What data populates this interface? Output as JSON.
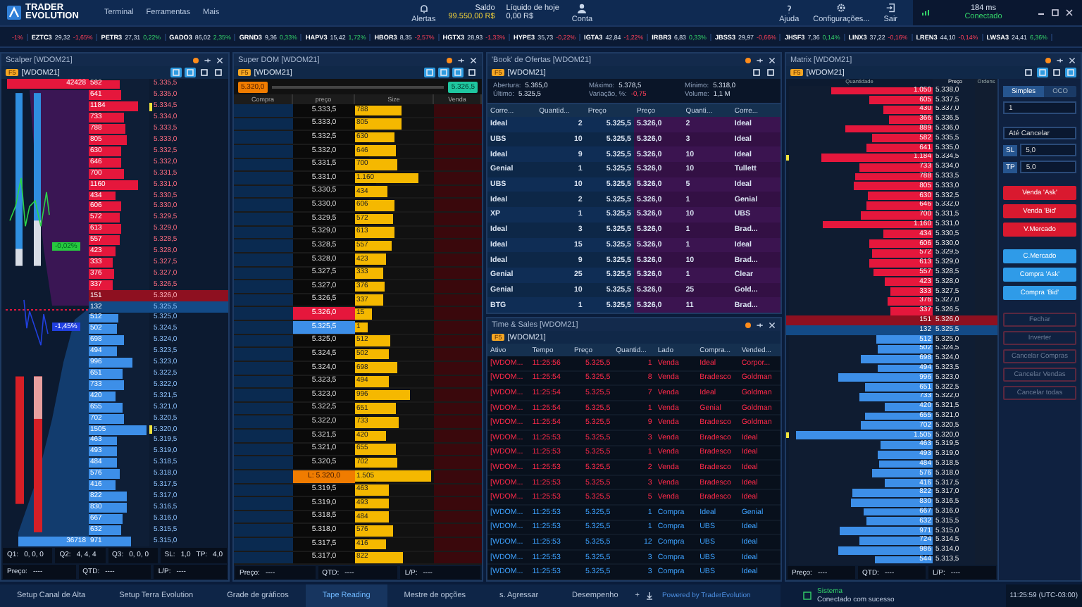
{
  "header": {
    "logo_top": "TRADER",
    "logo_bottom": "EVOLUTION",
    "menu": [
      "Terminal",
      "Ferramentas",
      "Mais"
    ],
    "alerts": "Alertas",
    "balance": {
      "label": "Saldo",
      "value": "99.550,00 R$"
    },
    "today": {
      "label": "Líquido de hoje",
      "value": "0,00 R$"
    },
    "account": "Conta",
    "actions": [
      {
        "label": "Ajuda",
        "kind": "help"
      },
      {
        "label": "Configurações...",
        "kind": "settings"
      },
      {
        "label": "Sair",
        "kind": "exit"
      }
    ],
    "latency": "184 ms",
    "connection": "Conectado"
  },
  "ticker": {
    "cut_change": "-1%",
    "items": [
      {
        "symbol": "EZTC3",
        "price": "29,32",
        "change": "-1,65%",
        "up": false
      },
      {
        "symbol": "PETR3",
        "price": "27,31",
        "change": "0,22%",
        "up": true
      },
      {
        "symbol": "GADO3",
        "price": "86,02",
        "change": "2,35%",
        "up": true
      },
      {
        "symbol": "GRND3",
        "price": "9,36",
        "change": "0,33%",
        "up": true
      },
      {
        "symbol": "HAPV3",
        "price": "15,42",
        "change": "1,72%",
        "up": true
      },
      {
        "symbol": "HBOR3",
        "price": "8,35",
        "change": "-2,57%",
        "up": false
      },
      {
        "symbol": "HGTX3",
        "price": "28,93",
        "change": "-1,33%",
        "up": false
      },
      {
        "symbol": "HYPE3",
        "price": "35,73",
        "change": "-0,22%",
        "up": false
      },
      {
        "symbol": "IGTA3",
        "price": "42,84",
        "change": "-1,22%",
        "up": false
      },
      {
        "symbol": "IRBR3",
        "price": "6,83",
        "change": "0,33%",
        "up": true
      },
      {
        "symbol": "JBSS3",
        "price": "29,97",
        "change": "-0,66%",
        "up": false
      },
      {
        "symbol": "JHSF3",
        "price": "7,36",
        "change": "0,14%",
        "up": true
      },
      {
        "symbol": "LINX3",
        "price": "37,22",
        "change": "-0,16%",
        "up": false
      },
      {
        "symbol": "LREN3",
        "price": "44,10",
        "change": "-0,14%",
        "up": false
      },
      {
        "symbol": "LWSA3",
        "price": "24,41",
        "change": "6,36%",
        "up": true
      }
    ]
  },
  "scalper": {
    "title": "Scalper [WDOM21]",
    "chip": "F5",
    "symbol": "[WDOM21]",
    "top_volume": "42428",
    "bottom_volume": "36718",
    "upper_change": "-0,02%",
    "lower_change": "-1,45%",
    "rows": [
      {
        "qty": "582",
        "price": "5.335,5",
        "kind": "ask",
        "level": 0.36,
        "flag": false
      },
      {
        "qty": "641",
        "price": "5.335,0",
        "kind": "ask",
        "level": 0.4,
        "flag": false
      },
      {
        "qty": "1184",
        "price": "5.334,5",
        "kind": "ask",
        "level": 0.74,
        "flag": true
      },
      {
        "qty": "733",
        "price": "5.334,0",
        "kind": "ask",
        "level": 0.46,
        "flag": false
      },
      {
        "qty": "788",
        "price": "5.333,5",
        "kind": "ask",
        "level": 0.49,
        "flag": false
      },
      {
        "qty": "805",
        "price": "5.333,0",
        "kind": "ask",
        "level": 0.5,
        "flag": false
      },
      {
        "qty": "630",
        "price": "5.332,5",
        "kind": "ask",
        "level": 0.39,
        "flag": false
      },
      {
        "qty": "646",
        "price": "5.332,0",
        "kind": "ask",
        "level": 0.4,
        "flag": false
      },
      {
        "qty": "700",
        "price": "5.331,5",
        "kind": "ask",
        "level": 0.44,
        "flag": false
      },
      {
        "qty": "1160",
        "price": "5.331,0",
        "kind": "ask",
        "level": 0.73,
        "flag": false
      },
      {
        "qty": "434",
        "price": "5.330,5",
        "kind": "ask",
        "level": 0.27,
        "flag": false
      },
      {
        "qty": "606",
        "price": "5.330,0",
        "kind": "ask",
        "level": 0.38,
        "flag": false
      },
      {
        "qty": "572",
        "price": "5.329,5",
        "kind": "ask",
        "level": 0.36,
        "flag": false
      },
      {
        "qty": "613",
        "price": "5.329,0",
        "kind": "ask",
        "level": 0.38,
        "flag": false
      },
      {
        "qty": "557",
        "price": "5.328,5",
        "kind": "ask",
        "level": 0.35,
        "flag": false
      },
      {
        "qty": "423",
        "price": "5.328,0",
        "kind": "ask",
        "level": 0.26,
        "flag": false
      },
      {
        "qty": "333",
        "price": "5.327,5",
        "kind": "ask",
        "level": 0.21,
        "flag": false
      },
      {
        "qty": "376",
        "price": "5.327,0",
        "kind": "ask",
        "level": 0.24,
        "flag": false
      },
      {
        "qty": "337",
        "price": "5.326,5",
        "kind": "ask",
        "level": 0.21,
        "flag": false
      },
      {
        "qty": "151",
        "price": "5.326,0",
        "kind": "best_ask",
        "flag": false
      },
      {
        "qty": "132",
        "price": "5.325,5",
        "kind": "best_bid",
        "flag": false
      },
      {
        "qty": "512",
        "price": "5.325,0",
        "kind": "bid",
        "level": 0.32,
        "flag": false
      },
      {
        "qty": "502",
        "price": "5.324,5",
        "kind": "bid",
        "level": 0.31,
        "flag": false
      },
      {
        "qty": "698",
        "price": "5.324,0",
        "kind": "bid",
        "level": 0.44,
        "flag": false
      },
      {
        "qty": "494",
        "price": "5.323,5",
        "kind": "bid",
        "level": 0.31,
        "flag": false
      },
      {
        "qty": "996",
        "price": "5.323,0",
        "kind": "bid",
        "level": 0.62,
        "flag": false
      },
      {
        "qty": "651",
        "price": "5.322,5",
        "kind": "bid",
        "level": 0.41,
        "flag": false
      },
      {
        "qty": "733",
        "price": "5.322,0",
        "kind": "bid",
        "level": 0.46,
        "flag": false
      },
      {
        "qty": "420",
        "price": "5.321,5",
        "kind": "bid",
        "level": 0.26,
        "flag": false
      },
      {
        "qty": "655",
        "price": "5.321,0",
        "kind": "bid",
        "level": 0.41,
        "flag": false
      },
      {
        "qty": "702",
        "price": "5.320,5",
        "kind": "bid",
        "level": 0.44,
        "flag": false
      },
      {
        "qty": "1505",
        "price": "5.320,0",
        "kind": "bid",
        "level": 0.94,
        "flag": true
      },
      {
        "qty": "463",
        "price": "5.319,5",
        "kind": "bid",
        "level": 0.29,
        "flag": false
      },
      {
        "qty": "493",
        "price": "5.319,0",
        "kind": "bid",
        "level": 0.31,
        "flag": false
      },
      {
        "qty": "484",
        "price": "5.318,5",
        "kind": "bid",
        "level": 0.3,
        "flag": false
      },
      {
        "qty": "576",
        "price": "5.318,0",
        "kind": "bid",
        "level": 0.36,
        "flag": false
      },
      {
        "qty": "416",
        "price": "5.317,5",
        "kind": "bid",
        "level": 0.26,
        "flag": false
      },
      {
        "qty": "822",
        "price": "5.317,0",
        "kind": "bid",
        "level": 0.51,
        "flag": false
      },
      {
        "qty": "830",
        "price": "5.316,5",
        "kind": "bid",
        "level": 0.52,
        "flag": false
      },
      {
        "qty": "667",
        "price": "5.316,0",
        "kind": "bid",
        "level": 0.42,
        "flag": false
      },
      {
        "qty": "632",
        "price": "5.315,5",
        "kind": "bid",
        "level": 0.4,
        "flag": false
      },
      {
        "qty": "971",
        "price": "5.315,0",
        "kind": "bid",
        "level": 0.61,
        "flag": false
      }
    ],
    "quantities": [
      {
        "label": "Q1:",
        "value": "0, 0, 0"
      },
      {
        "label": "Q2:",
        "value": "4, 4, 4"
      },
      {
        "label": "Q3:",
        "value": "0, 0, 0"
      }
    ],
    "sl": {
      "label": "SL:",
      "value": "1,0"
    },
    "tp": {
      "label": "TP:",
      "value": "4,0"
    },
    "footer": [
      {
        "label": "Preço:",
        "value": "----"
      },
      {
        "label": "QTD:",
        "value": "----"
      },
      {
        "label": "L/P:",
        "value": "----"
      }
    ]
  },
  "super_dom": {
    "title": "Super DOM [WDOM21]",
    "chip": "F5",
    "symbol": "[WDOM21]",
    "low": "5.320,0",
    "high": "5.326,5",
    "columns": [
      "Compra",
      "preço",
      "Size",
      "Venda"
    ],
    "rows": [
      {
        "price": "5.333,5",
        "size": "788",
        "kind": "ask",
        "level": 0.49
      },
      {
        "price": "5.333,0",
        "size": "805",
        "kind": "ask",
        "level": 0.5
      },
      {
        "price": "5.332,5",
        "size": "630",
        "kind": "ask",
        "level": 0.39
      },
      {
        "price": "5.332,0",
        "size": "646",
        "kind": "ask",
        "level": 0.4
      },
      {
        "price": "5.331,5",
        "size": "700",
        "kind": "ask",
        "level": 0.44
      },
      {
        "price": "5.331,0",
        "size": "1.160",
        "kind": "ask",
        "level": 0.73
      },
      {
        "price": "5.330,5",
        "size": "434",
        "kind": "ask",
        "level": 0.27
      },
      {
        "price": "5.330,0",
        "size": "606",
        "kind": "ask",
        "level": 0.38
      },
      {
        "price": "5.329,5",
        "size": "572",
        "kind": "ask",
        "level": 0.36
      },
      {
        "price": "5.329,0",
        "size": "613",
        "kind": "ask",
        "level": 0.38
      },
      {
        "price": "5.328,5",
        "size": "557",
        "kind": "ask",
        "level": 0.35
      },
      {
        "price": "5.328,0",
        "size": "423",
        "kind": "ask",
        "level": 0.26
      },
      {
        "price": "5.327,5",
        "size": "333",
        "kind": "ask",
        "level": 0.21
      },
      {
        "price": "5.327,0",
        "size": "376",
        "kind": "ask",
        "level": 0.24
      },
      {
        "price": "5.326,5",
        "size": "337",
        "kind": "ask",
        "level": 0.21
      },
      {
        "price": "5.326,0",
        "size": "15",
        "kind": "best_ask",
        "level": 0.09
      },
      {
        "price": "5.325,5",
        "size": "1",
        "kind": "best_bid",
        "level": 0.08
      },
      {
        "price": "5.325,0",
        "size": "512",
        "kind": "bid",
        "level": 0.32
      },
      {
        "price": "5.324,5",
        "size": "502",
        "kind": "bid",
        "level": 0.31
      },
      {
        "price": "5.324,0",
        "size": "698",
        "kind": "bid",
        "level": 0.44
      },
      {
        "price": "5.323,5",
        "size": "494",
        "kind": "bid",
        "level": 0.31
      },
      {
        "price": "5.323,0",
        "size": "996",
        "kind": "bid",
        "level": 0.62
      },
      {
        "price": "5.322,5",
        "size": "651",
        "kind": "bid",
        "level": 0.41
      },
      {
        "price": "5.322,0",
        "size": "733",
        "kind": "bid",
        "level": 0.46
      },
      {
        "price": "5.321,5",
        "size": "420",
        "kind": "bid",
        "level": 0.26
      },
      {
        "price": "5.321,0",
        "size": "655",
        "kind": "bid",
        "level": 0.41
      },
      {
        "price": "5.320,5",
        "size": "702",
        "kind": "bid",
        "level": 0.44
      },
      {
        "price": "L: 5.320,0",
        "size": "1.505",
        "kind": "order",
        "level": 0.94
      },
      {
        "price": "5.319,5",
        "size": "463",
        "kind": "bid",
        "level": 0.29
      },
      {
        "price": "5.319,0",
        "size": "493",
        "kind": "bid",
        "level": 0.31
      },
      {
        "price": "5.318,5",
        "size": "484",
        "kind": "bid",
        "level": 0.3
      },
      {
        "price": "5.318,0",
        "size": "576",
        "kind": "bid",
        "level": 0.36
      },
      {
        "price": "5.317,5",
        "size": "416",
        "kind": "bid",
        "level": 0.26
      },
      {
        "price": "5.317,0",
        "size": "822",
        "kind": "bid",
        "level": 0.51
      }
    ],
    "footer": [
      {
        "label": "Preço:",
        "value": "----"
      },
      {
        "label": "QTD:",
        "value": "----"
      },
      {
        "label": "L/P:",
        "value": "----"
      }
    ]
  },
  "book": {
    "title": "'Book' de Ofertas [WDOM21]",
    "chip": "F5",
    "symbol": "[WDOM21]",
    "stats": [
      {
        "label": "Abertura:",
        "value": "5.365,0",
        "down": false
      },
      {
        "label": "Máximo:",
        "value": "5.378,5",
        "down": false
      },
      {
        "label": "Mínimo:",
        "value": "5.318,0",
        "down": false
      },
      {
        "label": "Último:",
        "value": "5.325,5",
        "down": false
      },
      {
        "label": "Variação, %:",
        "value": "-0,75",
        "down": true
      },
      {
        "label": "Volume:",
        "value": "1,1 M",
        "down": false
      }
    ],
    "columns": [
      "Corre...",
      "Quantid...",
      "Preço",
      "Preço",
      "Quanti...",
      "Corre..."
    ],
    "rows": [
      [
        "Ideal",
        "2",
        "5.325,5",
        "5.326,0",
        "2",
        "Ideal"
      ],
      [
        "UBS",
        "10",
        "5.325,5",
        "5.326,0",
        "3",
        "Ideal"
      ],
      [
        "Ideal",
        "9",
        "5.325,5",
        "5.326,0",
        "10",
        "Ideal"
      ],
      [
        "Genial",
        "1",
        "5.325,5",
        "5.326,0",
        "10",
        "Tullett"
      ],
      [
        "UBS",
        "10",
        "5.325,5",
        "5.326,0",
        "5",
        "Ideal"
      ],
      [
        "Ideal",
        "2",
        "5.325,5",
        "5.326,0",
        "1",
        "Genial"
      ],
      [
        "XP",
        "1",
        "5.325,5",
        "5.326,0",
        "10",
        "UBS"
      ],
      [
        "Ideal",
        "3",
        "5.325,5",
        "5.326,0",
        "1",
        "Brad..."
      ],
      [
        "Ideal",
        "15",
        "5.325,5",
        "5.326,0",
        "1",
        "Ideal"
      ],
      [
        "Ideal",
        "9",
        "5.325,5",
        "5.326,0",
        "10",
        "Brad..."
      ],
      [
        "Genial",
        "25",
        "5.325,5",
        "5.326,0",
        "1",
        "Clear"
      ],
      [
        "Genial",
        "10",
        "5.325,5",
        "5.326,0",
        "25",
        "Gold..."
      ],
      [
        "BTG",
        "1",
        "5.325,5",
        "5.326,0",
        "11",
        "Brad..."
      ]
    ]
  },
  "time_sales": {
    "title": "Time & Sales [WDOM21]",
    "chip": "F5",
    "symbol": "[WDOM21]",
    "columns": [
      "Ativo",
      "Tempo",
      "Preço",
      "Quantid...",
      "Lado",
      "Compra...",
      "Vended..."
    ],
    "rows": [
      {
        "kind": "sell",
        "cells": [
          "[WDOM...",
          "11:25:56",
          "5.325,5",
          "1",
          "Venda",
          "Ideal",
          "Corpor..."
        ]
      },
      {
        "kind": "sell",
        "cells": [
          "[WDOM...",
          "11:25:54",
          "5.325,5",
          "8",
          "Venda",
          "Bradesco",
          "Goldman"
        ]
      },
      {
        "kind": "sell",
        "cells": [
          "[WDOM...",
          "11:25:54",
          "5.325,5",
          "7",
          "Venda",
          "Ideal",
          "Goldman"
        ]
      },
      {
        "kind": "sell",
        "cells": [
          "[WDOM...",
          "11:25:54",
          "5.325,5",
          "1",
          "Venda",
          "Genial",
          "Goldman"
        ]
      },
      {
        "kind": "sell",
        "cells": [
          "[WDOM...",
          "11:25:54",
          "5.325,5",
          "9",
          "Venda",
          "Bradesco",
          "Goldman"
        ]
      },
      {
        "kind": "sell",
        "cells": [
          "[WDOM...",
          "11:25:53",
          "5.325,5",
          "3",
          "Venda",
          "Bradesco",
          "Ideal"
        ]
      },
      {
        "kind": "sell",
        "cells": [
          "[WDOM...",
          "11:25:53",
          "5.325,5",
          "1",
          "Venda",
          "Bradesco",
          "Ideal"
        ]
      },
      {
        "kind": "sell",
        "cells": [
          "[WDOM...",
          "11:25:53",
          "5.325,5",
          "2",
          "Venda",
          "Bradesco",
          "Ideal"
        ]
      },
      {
        "kind": "sell",
        "cells": [
          "[WDOM...",
          "11:25:53",
          "5.325,5",
          "3",
          "Venda",
          "Bradesco",
          "Ideal"
        ]
      },
      {
        "kind": "sell",
        "cells": [
          "[WDOM...",
          "11:25:53",
          "5.325,5",
          "5",
          "Venda",
          "Bradesco",
          "Ideal"
        ]
      },
      {
        "kind": "buy",
        "cells": [
          "[WDOM...",
          "11:25:53",
          "5.325,5",
          "1",
          "Compra",
          "Ideal",
          "Genial"
        ]
      },
      {
        "kind": "buy",
        "cells": [
          "[WDOM...",
          "11:25:53",
          "5.325,5",
          "1",
          "Compra",
          "UBS",
          "Ideal"
        ]
      },
      {
        "kind": "buy",
        "cells": [
          "[WDOM...",
          "11:25:53",
          "5.325,5",
          "12",
          "Compra",
          "UBS",
          "Ideal"
        ]
      },
      {
        "kind": "buy",
        "cells": [
          "[WDOM...",
          "11:25:53",
          "5.325,5",
          "3",
          "Compra",
          "UBS",
          "Ideal"
        ]
      },
      {
        "kind": "buy",
        "cells": [
          "[WDOM...",
          "11:25:53",
          "5.325,5",
          "3",
          "Compra",
          "UBS",
          "Ideal"
        ]
      }
    ]
  },
  "matrix": {
    "title": "Matrix [WDOM21]",
    "chip": "F5",
    "symbol": "[WDOM21]",
    "columns": [
      "Quantidade",
      "Preço",
      "Ordens"
    ],
    "rows": [
      {
        "qty": "1.050",
        "price": "5.338,0",
        "kind": "ask",
        "level": 0.66,
        "flag": false
      },
      {
        "qty": "605",
        "price": "5.337,5",
        "kind": "ask",
        "level": 0.38,
        "flag": false
      },
      {
        "qty": "430",
        "price": "5.337,0",
        "kind": "ask",
        "level": 0.27,
        "flag": false
      },
      {
        "qty": "366",
        "price": "5.336,5",
        "kind": "ask",
        "level": 0.23,
        "flag": false
      },
      {
        "qty": "889",
        "price": "5.336,0",
        "kind": "ask",
        "level": 0.56,
        "flag": false
      },
      {
        "qty": "582",
        "price": "5.335,5",
        "kind": "ask",
        "level": 0.36,
        "flag": false
      },
      {
        "qty": "641",
        "price": "5.335,0",
        "kind": "ask",
        "level": 0.4,
        "flag": false
      },
      {
        "qty": "1.184",
        "price": "5.334,5",
        "kind": "ask",
        "level": 0.74,
        "flag": true
      },
      {
        "qty": "733",
        "price": "5.334,0",
        "kind": "ask",
        "level": 0.46,
        "flag": false
      },
      {
        "qty": "788",
        "price": "5.333,5",
        "kind": "ask",
        "level": 0.49,
        "flag": false
      },
      {
        "qty": "805",
        "price": "5.333,0",
        "kind": "ask",
        "level": 0.5,
        "flag": false
      },
      {
        "qty": "630",
        "price": "5.332,5",
        "kind": "ask",
        "level": 0.39,
        "flag": false
      },
      {
        "qty": "646",
        "price": "5.332,0",
        "kind": "ask",
        "level": 0.4,
        "flag": false
      },
      {
        "qty": "700",
        "price": "5.331,5",
        "kind": "ask",
        "level": 0.44,
        "flag": false
      },
      {
        "qty": "1.160",
        "price": "5.331,0",
        "kind": "ask",
        "level": 0.73,
        "flag": false
      },
      {
        "qty": "434",
        "price": "5.330,5",
        "kind": "ask",
        "level": 0.27,
        "flag": false
      },
      {
        "qty": "606",
        "price": "5.330,0",
        "kind": "ask",
        "level": 0.38,
        "flag": false
      },
      {
        "qty": "572",
        "price": "5.329,5",
        "kind": "ask",
        "level": 0.36,
        "flag": false
      },
      {
        "qty": "613",
        "price": "5.329,0",
        "kind": "ask",
        "level": 0.38,
        "flag": false
      },
      {
        "qty": "557",
        "price": "5.328,5",
        "kind": "ask",
        "level": 0.35,
        "flag": false
      },
      {
        "qty": "423",
        "price": "5.328,0",
        "kind": "ask",
        "level": 0.26,
        "flag": false
      },
      {
        "qty": "333",
        "price": "5.327,5",
        "kind": "ask",
        "level": 0.21,
        "flag": false
      },
      {
        "qty": "376",
        "price": "5.327,0",
        "kind": "ask",
        "level": 0.24,
        "flag": false
      },
      {
        "qty": "337",
        "price": "5.326,5",
        "kind": "ask",
        "level": 0.21,
        "flag": false
      },
      {
        "qty": "151",
        "price": "5.326,0",
        "kind": "best_ask",
        "flag": false
      },
      {
        "qty": "132",
        "price": "5.325,5",
        "kind": "best_bid",
        "flag": false
      },
      {
        "qty": "512",
        "price": "5.325,0",
        "kind": "bid",
        "level": 0.32,
        "flag": false
      },
      {
        "qty": "502",
        "price": "5.324,5",
        "kind": "bid",
        "level": 0.31,
        "flag": false
      },
      {
        "qty": "698",
        "price": "5.324,0",
        "kind": "bid",
        "level": 0.44,
        "flag": false
      },
      {
        "qty": "494",
        "price": "5.323,5",
        "kind": "bid",
        "level": 0.31,
        "flag": false
      },
      {
        "qty": "996",
        "price": "5.323,0",
        "kind": "bid",
        "level": 0.62,
        "flag": false
      },
      {
        "qty": "651",
        "price": "5.322,5",
        "kind": "bid",
        "level": 0.41,
        "flag": false
      },
      {
        "qty": "733",
        "price": "5.322,0",
        "kind": "bid",
        "level": 0.46,
        "flag": false
      },
      {
        "qty": "420",
        "price": "5.321,5",
        "kind": "bid",
        "level": 0.26,
        "flag": false
      },
      {
        "qty": "655",
        "price": "5.321,0",
        "kind": "bid",
        "level": 0.41,
        "flag": false
      },
      {
        "qty": "702",
        "price": "5.320,5",
        "kind": "bid",
        "level": 0.44,
        "flag": false
      },
      {
        "qty": "1.505",
        "price": "5.320,0",
        "kind": "bid",
        "level": 0.94,
        "flag": true
      },
      {
        "qty": "463",
        "price": "5.319,5",
        "kind": "bid",
        "level": 0.29,
        "flag": false
      },
      {
        "qty": "493",
        "price": "5.319,0",
        "kind": "bid",
        "level": 0.31,
        "flag": false
      },
      {
        "qty": "484",
        "price": "5.318,5",
        "kind": "bid",
        "level": 0.3,
        "flag": false
      },
      {
        "qty": "576",
        "price": "5.318,0",
        "kind": "bid",
        "level": 0.36,
        "flag": false
      },
      {
        "qty": "416",
        "price": "5.317,5",
        "kind": "bid",
        "level": 0.26,
        "flag": false
      },
      {
        "qty": "822",
        "price": "5.317,0",
        "kind": "bid",
        "level": 0.51,
        "flag": false
      },
      {
        "qty": "830",
        "price": "5.316,5",
        "kind": "bid",
        "level": 0.52,
        "flag": false
      },
      {
        "qty": "667",
        "price": "5.316,0",
        "kind": "bid",
        "level": 0.42,
        "flag": false
      },
      {
        "qty": "632",
        "price": "5.315,5",
        "kind": "bid",
        "level": 0.4,
        "flag": false
      },
      {
        "qty": "971",
        "price": "5.315,0",
        "kind": "bid",
        "level": 0.61,
        "flag": false
      },
      {
        "qty": "724",
        "price": "5.314,5",
        "kind": "bid",
        "level": 0.45,
        "flag": false
      },
      {
        "qty": "986",
        "price": "5.314,0",
        "kind": "bid",
        "level": 0.62,
        "flag": false
      },
      {
        "qty": "544",
        "price": "5.313,5",
        "kind": "bid",
        "level": 0.34,
        "flag": false
      }
    ],
    "footer": [
      {
        "label": "Preço:",
        "value": "----"
      },
      {
        "label": "QTD:",
        "value": "----"
      },
      {
        "label": "L/P:",
        "value": "----"
      }
    ],
    "order_types": [
      {
        "label": "Simples",
        "selected": true
      },
      {
        "label": "OCO",
        "selected": false
      }
    ],
    "quantity": "1",
    "validity": "Até Cancelar",
    "sl": {
      "label": "SL",
      "value": "5,0"
    },
    "tp": {
      "label": "TP",
      "value": "5,0"
    },
    "buttons": [
      {
        "label": "Venda 'Ask'",
        "kind": "sell"
      },
      {
        "label": "Venda 'Bid'",
        "kind": "sell"
      },
      {
        "label": "V.Mercado",
        "kind": "sell"
      },
      {
        "label": "C.Mercado",
        "kind": "buy"
      },
      {
        "label": "Compra 'Ask'",
        "kind": "buy"
      },
      {
        "label": "Compra 'Bid'",
        "kind": "buy"
      },
      {
        "label": "Fechar",
        "kind": "disabled"
      },
      {
        "label": "Inverter",
        "kind": "disabled"
      },
      {
        "label": "Cancelar Compras",
        "kind": "disabled"
      },
      {
        "label": "Cancelar Vendas",
        "kind": "disabled"
      },
      {
        "label": "Cancelar todas",
        "kind": "disabled"
      }
    ]
  },
  "workspace_tabs": [
    {
      "label": "Setup Canal de Alta",
      "selected": false
    },
    {
      "label": "Setup Terra Evolution",
      "selected": false
    },
    {
      "label": "Grade de gráficos",
      "selected": false
    },
    {
      "label": "Tape Reading",
      "selected": true
    },
    {
      "label": "Mestre de opções",
      "selected": false
    },
    {
      "label": "s. Agressar",
      "selected": false
    },
    {
      "label": "Desempenho",
      "selected": false
    }
  ],
  "add_tab": "+",
  "powered": "Powered by TraderEvolution",
  "status": {
    "title": "Sistema",
    "message": "Conectado com sucesso",
    "time": "11:25:59 (UTC-03:00)"
  }
}
